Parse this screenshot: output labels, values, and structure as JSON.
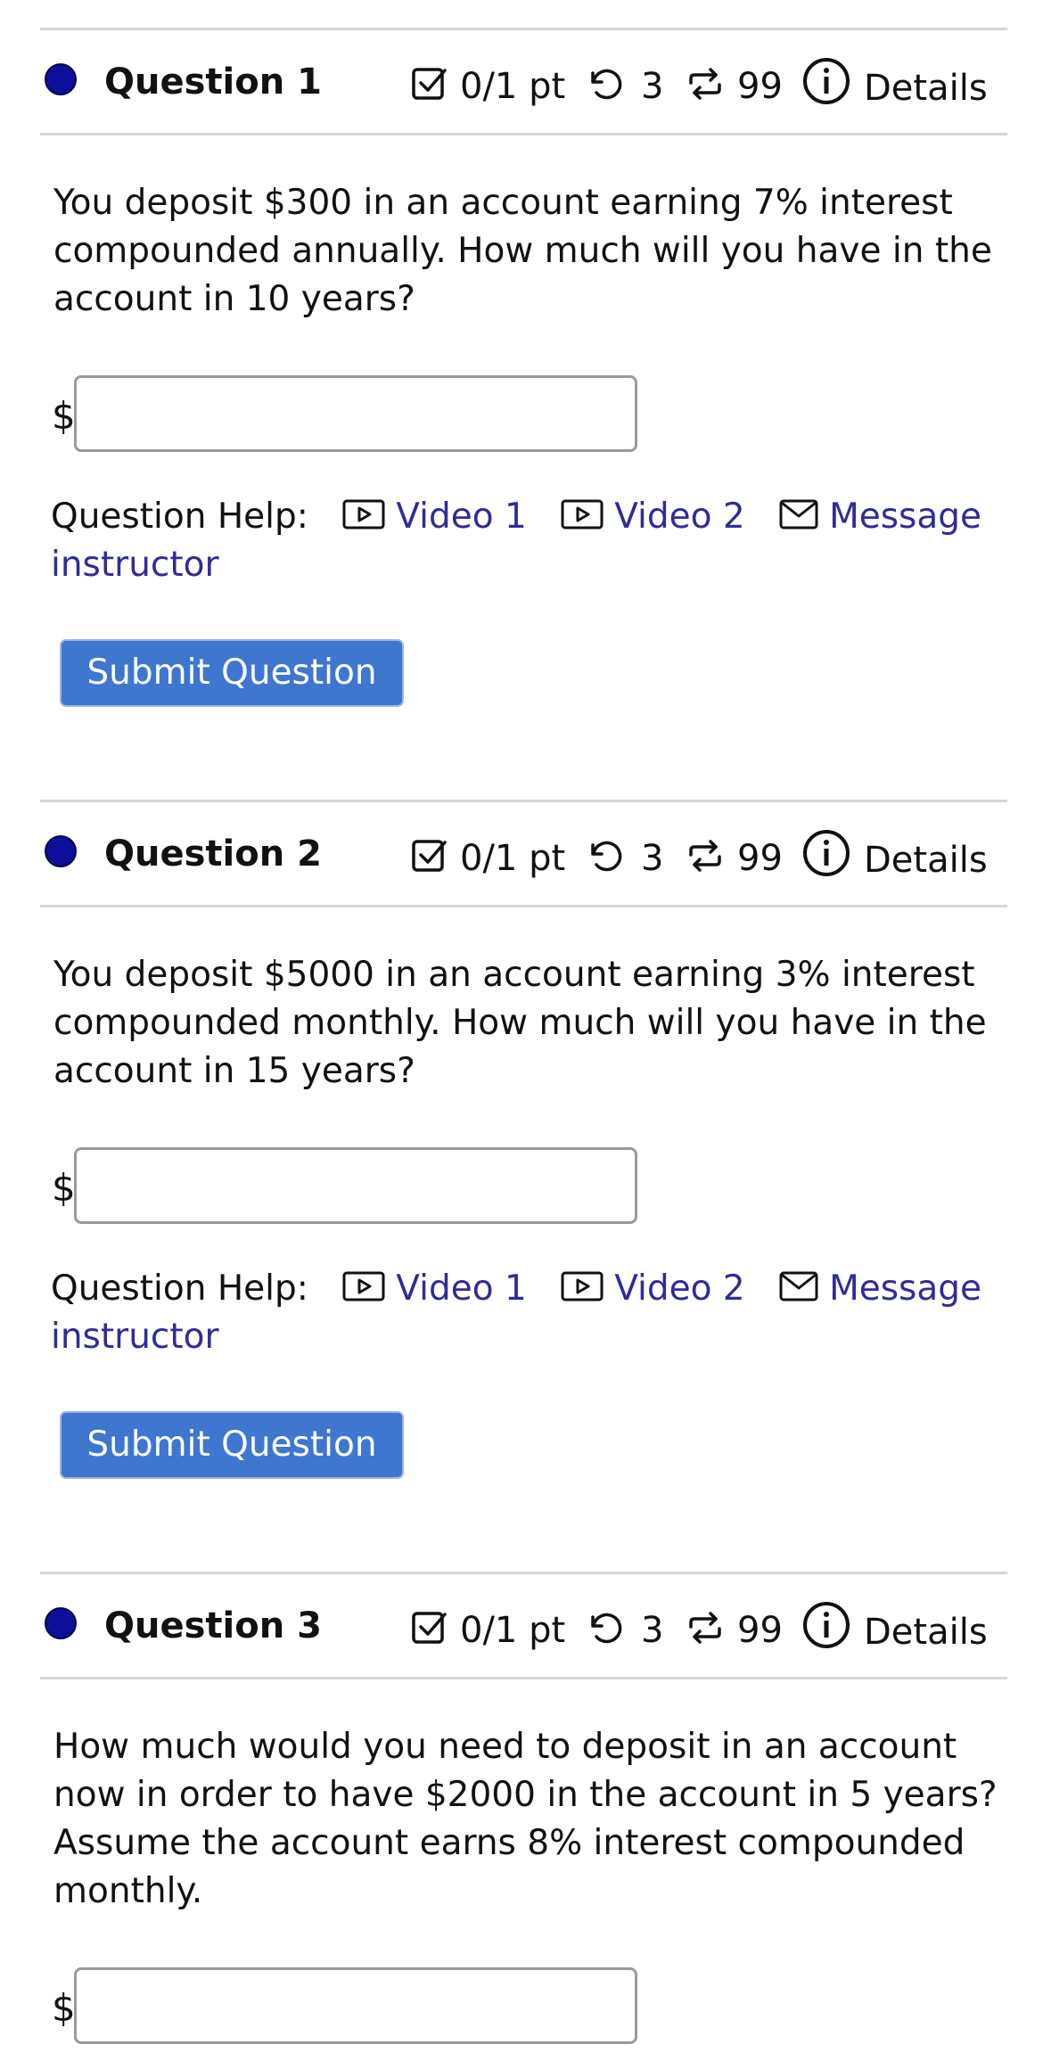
{
  "meta_labels": {
    "points": "0/1 pt",
    "retries": "3",
    "attempts": "99",
    "details": "Details"
  },
  "help": {
    "label": "Question Help:",
    "video1": "Video 1",
    "video2": "Video 2",
    "message": "Message instructor"
  },
  "currency_symbol": "$",
  "submit_label": "Submit Question",
  "questions": [
    {
      "title": "Question 1",
      "text": "You deposit $300 in an account earning 7% interest compounded annually. How much will you have in the account in 10 years?",
      "answer_value": ""
    },
    {
      "title": "Question 2",
      "text": "You deposit $5000 in an account earning 3% interest compounded monthly. How much will you have in the account in 15 years?",
      "answer_value": ""
    },
    {
      "title": "Question 3",
      "text": "How much would you need to deposit in an account now in order to have $2000 in the account in 5 years? Assume the account earns 8% interest compounded monthly.",
      "answer_value": ""
    }
  ],
  "colors": {
    "status_dot": "#0d0f9a",
    "link": "#2e2c9a",
    "submit_button": "#3e76d0"
  },
  "icons": [
    "checkbox-icon",
    "retry-icon",
    "attempts-icon",
    "info-icon",
    "video-icon",
    "mail-icon"
  ]
}
